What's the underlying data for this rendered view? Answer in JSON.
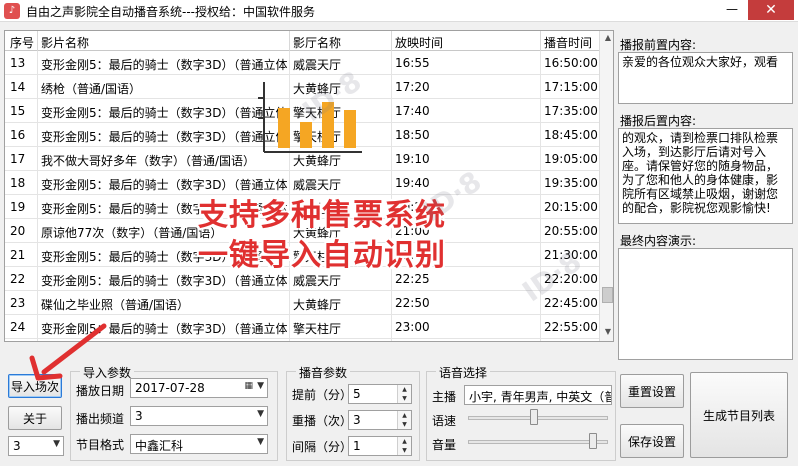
{
  "window": {
    "title": "自由之声影院全自动播音系统---授权给：中国软件服务",
    "minimize_glyph": "—",
    "close_glyph": "✕"
  },
  "grid": {
    "headers": [
      "序号",
      "影片名称",
      "影厅名称",
      "放映时间",
      "播音时间"
    ],
    "rows": [
      [
        "13",
        "变形金刚5：最后的骑士（数字3D）（普通立体",
        "威震天厅",
        "16:55",
        "16:50:00"
      ],
      [
        "14",
        "绣枪（普通/国语）",
        "大黄蜂厅",
        "17:20",
        "17:15:00"
      ],
      [
        "15",
        "变形金刚5：最后的骑士（数字3D）（普通立体",
        "擎天柱厅",
        "17:40",
        "17:35:00"
      ],
      [
        "16",
        "变形金刚5：最后的骑士（数字3D）（普通立体",
        "擎天柱厅",
        "18:50",
        "18:45:00"
      ],
      [
        "17",
        "我不做大哥好多年（数字）（普通/国语）",
        "大黄蜂厅",
        "19:10",
        "19:05:00"
      ],
      [
        "18",
        "变形金刚5：最后的骑士（数字3D）（普通立体",
        "威震天厅",
        "19:40",
        "19:35:00"
      ],
      [
        "19",
        "变形金刚5：最后的骑士（数字3D）（普通立体",
        "擎天柱厅",
        "20:20",
        "20:15:00"
      ],
      [
        "20",
        "原谅他77次（数字）（普通/国语）",
        "大黄蜂厅",
        "21:00",
        "20:55:00"
      ],
      [
        "21",
        "变形金刚5：最后的骑士（数字3D）（普通立体",
        "擎天柱厅",
        "21:35",
        "21:30:00"
      ],
      [
        "22",
        "变形金刚5：最后的骑士（数字3D）（普通立体",
        "威震天厅",
        "22:25",
        "22:20:00"
      ],
      [
        "23",
        "碟仙之毕业照（普通/国语）",
        "大黄蜂厅",
        "22:50",
        "22:45:00"
      ],
      [
        "24",
        "变形金刚5：最后的骑士（数字3D）（普通立体",
        "擎天柱厅",
        "23:00",
        "22:55:00"
      ]
    ]
  },
  "right_panel": {
    "pre_label": "播报前置内容:",
    "pre_text": "亲爱的各位观众大家好，观看",
    "post_label": "播报后置内容:",
    "post_text": "的观众，请到检票口排队检票入场，到达影厅后请对号入座。请保管好您的随身物品，为了您和他人的身体健康，影院所有区域禁止吸烟，谢谢您的配合，影院祝您观影愉快!",
    "final_label": "最终内容演示:",
    "final_text": ""
  },
  "left_buttons": {
    "import": "导入场次",
    "about": "关于",
    "num_select": "3"
  },
  "import_params": {
    "title": "导入参数",
    "date_label": "播放日期",
    "date_value": "2017-07-28",
    "channel_label": "播出频道",
    "channel_value": "3",
    "format_label": "节目格式",
    "format_value": "中鑫汇科"
  },
  "broadcast_params": {
    "title": "播音参数",
    "advance_label": "提前（分）:",
    "advance_value": "5",
    "repeat_label": "重播（次）:",
    "repeat_value": "3",
    "interval_label": "间隔（分）:",
    "interval_value": "1"
  },
  "voice": {
    "title": "语音选择",
    "anchor_label": "主播",
    "anchor_value": "小宇, 青年男声, 中英文（普",
    "speed_label": "语速",
    "volume_label": "音量",
    "speed_level": 0.47,
    "volume_level": 0.92
  },
  "action_buttons": {
    "reset": "重置设置",
    "save": "保存设置",
    "generate": "生成节目列表"
  },
  "promo": {
    "line1": "支持多种售票系统",
    "line2": "一键导入自动识别"
  },
  "colors": {
    "promo_red": "#e03030",
    "chart_bars": "#f5a623",
    "arrow": "#e03030"
  },
  "icons": {
    "app": "app-icon",
    "calendar": "calendar-icon",
    "chart_overlay": "bar-chart-icon"
  }
}
